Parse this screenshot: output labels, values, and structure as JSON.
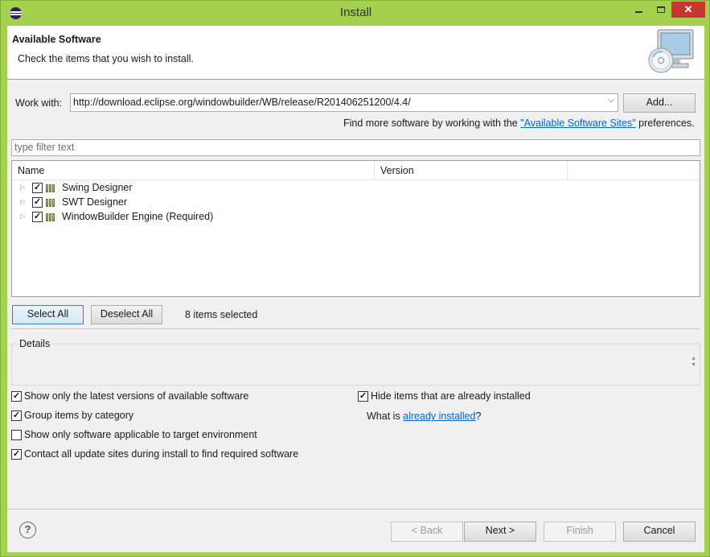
{
  "window": {
    "title": "Install",
    "close_glyph": "✕",
    "app_icon": "eclipse-icon"
  },
  "banner": {
    "title": "Available Software",
    "description": "Check the items that you wish to install.",
    "icon": "install-cd-computer-icon"
  },
  "work_with": {
    "label": "Work with:",
    "url": "http://download.eclipse.org/windowbuilder/WB/release/R201406251200/4.4/",
    "add_label": "Add...",
    "find_more_prefix": "Find more software by working with the ",
    "find_more_link": "\"Available Software Sites\"",
    "find_more_suffix": " preferences."
  },
  "filter": {
    "placeholder": "type filter text"
  },
  "tree": {
    "columns": [
      "Name",
      "Version"
    ],
    "items": [
      {
        "label": "Swing Designer",
        "checked": true
      },
      {
        "label": "SWT Designer",
        "checked": true
      },
      {
        "label": "WindowBuilder Engine (Required)",
        "checked": true
      }
    ]
  },
  "selection": {
    "select_all": "Select All",
    "deselect_all": "Deselect All",
    "count_text": "8 items selected"
  },
  "details": {
    "label": "Details"
  },
  "options": {
    "latest_versions": {
      "label": "Show only the latest versions of available software",
      "checked": true
    },
    "group_by_category": {
      "label": "Group items by category",
      "checked": true
    },
    "applicable_only": {
      "label": "Show only software applicable to target environment",
      "checked": false
    },
    "contact_sites": {
      "label": "Contact all update sites during install to find required software",
      "checked": true
    },
    "hide_installed": {
      "label": "Hide items that are already installed",
      "checked": true
    },
    "what_is_prefix": "What is ",
    "what_is_link": "already installed",
    "what_is_suffix": "?"
  },
  "footer": {
    "help_glyph": "?",
    "back": "< Back",
    "next": "Next >",
    "finish": "Finish",
    "cancel": "Cancel"
  },
  "check_glyph": "✓",
  "colors": {
    "window_frame": "#a3d14f",
    "close_button": "#c7372f",
    "link": "#0066cc"
  }
}
